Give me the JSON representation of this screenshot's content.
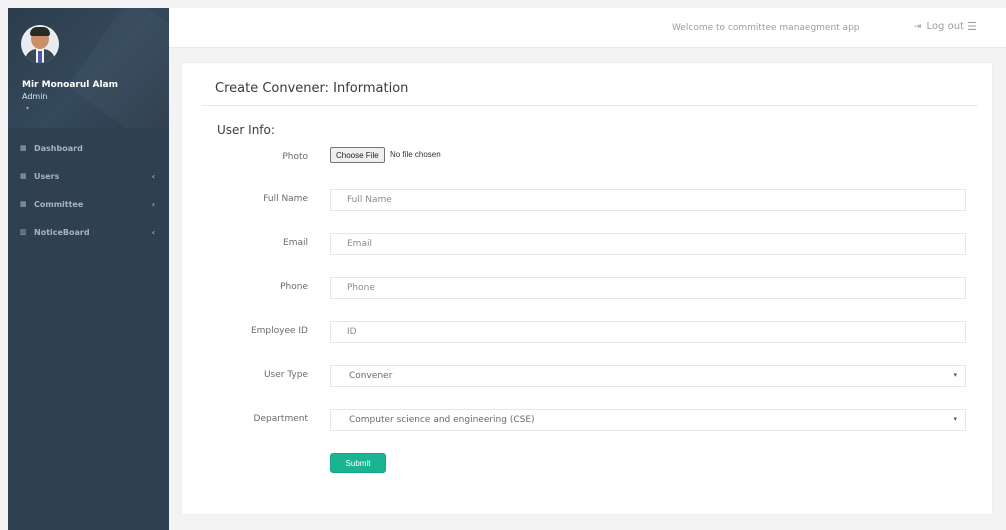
{
  "sidebar": {
    "profile": {
      "name": "Mir Monoarul Alam",
      "role": "Admin",
      "caret": "▾"
    },
    "items": [
      {
        "label": "Dashboard",
        "icon": "th-large-icon",
        "glyph": "▦",
        "has_arrow": false
      },
      {
        "label": "Users",
        "icon": "th-large-icon",
        "glyph": "▦",
        "has_arrow": true
      },
      {
        "label": "Committee",
        "icon": "th-large-icon",
        "glyph": "▦",
        "has_arrow": true
      },
      {
        "label": "NoticeBoard",
        "icon": "bar-chart-icon",
        "glyph": "▥",
        "has_arrow": true
      }
    ],
    "arrow": "‹"
  },
  "topbar": {
    "welcome": "Welcome to committee manaegment app",
    "logout_label": "Log out",
    "logout_icon": "⇥",
    "menu_icon": "☰"
  },
  "panel": {
    "title": "Create Convener: Information",
    "section": "User Info:",
    "photo": {
      "label": "Photo",
      "button": "Choose File",
      "status": "No file chosen"
    },
    "full_name": {
      "label": "Full Name",
      "placeholder": "Full Name"
    },
    "email": {
      "label": "Email",
      "placeholder": "Email"
    },
    "phone": {
      "label": "Phone",
      "placeholder": "Phone"
    },
    "employee_id": {
      "label": "Employee ID",
      "placeholder": "ID"
    },
    "user_type": {
      "label": "User Type",
      "value": "Convener"
    },
    "department": {
      "label": "Department",
      "value": "Computer science and engineering (CSE)"
    },
    "select_caret": "▾",
    "submit": "Submit"
  },
  "colors": {
    "sidebar_bg": "#2f4050",
    "accent": "#1ab394",
    "page_bg": "#f3f3f4"
  }
}
